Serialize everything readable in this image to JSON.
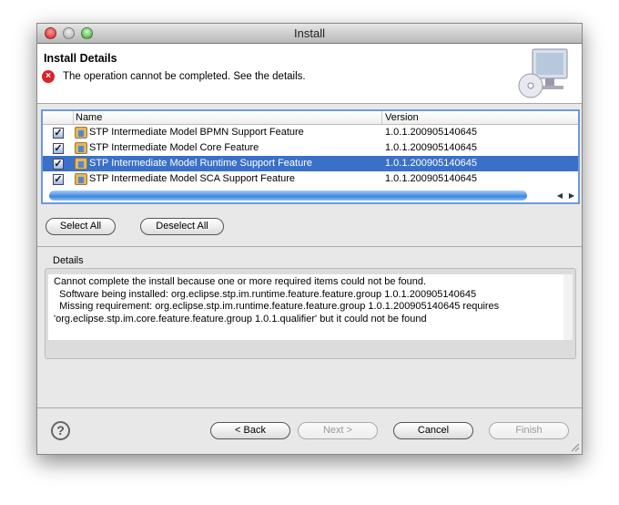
{
  "window": {
    "title": "Install"
  },
  "header": {
    "title": "Install Details",
    "message": "The operation cannot be completed.  See the details."
  },
  "table": {
    "columns": [
      "Name",
      "Version"
    ],
    "rows": [
      {
        "name": "STP Intermediate Model BPMN Support Feature",
        "version": "1.0.1.200905140645",
        "checked": true,
        "selected": false
      },
      {
        "name": "STP Intermediate Model Core Feature",
        "version": "1.0.1.200905140645",
        "checked": true,
        "selected": false
      },
      {
        "name": "STP Intermediate Model Runtime Support Feature",
        "version": "1.0.1.200905140645",
        "checked": true,
        "selected": true
      },
      {
        "name": "STP Intermediate Model SCA Support Feature",
        "version": "1.0.1.200905140645",
        "checked": true,
        "selected": false
      }
    ]
  },
  "buttons": {
    "select_all": "Select All",
    "deselect_all": "Deselect All",
    "back": "< Back",
    "next": "Next >",
    "cancel": "Cancel",
    "finish": "Finish"
  },
  "details": {
    "label": "Details",
    "text": "Cannot complete the install because one or more required items could not be found.\n  Software being installed: org.eclipse.stp.im.runtime.feature.feature.group 1.0.1.200905140645\n  Missing requirement: org.eclipse.stp.im.runtime.feature.feature.group 1.0.1.200905140645 requires\n'org.eclipse.stp.im.core.feature.feature.group 1.0.1.qualifier' but it could not be found"
  }
}
